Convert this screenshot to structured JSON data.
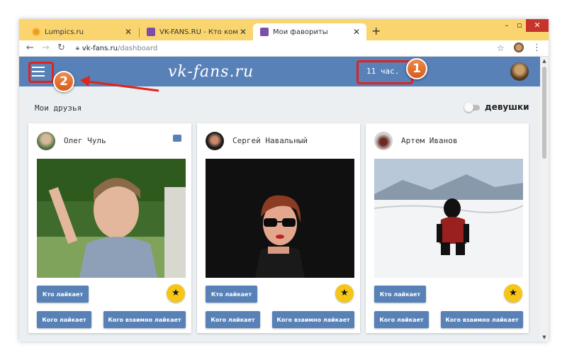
{
  "browser": {
    "tabs": [
      {
        "title": "Lumpics.ru",
        "favicon": "lumpics-favicon"
      },
      {
        "title": "VK-FANS.RU - Кто кому ставит л",
        "favicon": "vk-fans-favicon"
      },
      {
        "title": "Мои фавориты",
        "favicon": "vk-fans-favicon"
      }
    ],
    "new_tab_label": "+",
    "window_controls": {
      "minimize": "–",
      "maximize": "▫",
      "close": "✕"
    },
    "url_host": "vk-fans.ru",
    "url_path": "/dashboard"
  },
  "app": {
    "logo": "vk-fans.ru",
    "timer": "11 час."
  },
  "friends_section": {
    "title": "Мои друзья",
    "toggle_label": "девушки"
  },
  "cards": [
    {
      "name": "Олег Чуль",
      "has_chat_icon": true
    },
    {
      "name": "Сергей Навальный",
      "has_chat_icon": false
    },
    {
      "name": "Артем Иванов",
      "has_chat_icon": false
    }
  ],
  "card_buttons": {
    "who_likes": "Кто лайкает",
    "whom_likes": "Кого лайкает",
    "mutual_likes": "Кого взаимно лайкает"
  },
  "annotations": {
    "badge_1": "1",
    "badge_2": "2",
    "highlight_color": "#e0231d",
    "badge_color": "#e06a27"
  },
  "colors": {
    "accent": "#5881b7",
    "star": "#f5c518",
    "window_frame": "#fad56f"
  }
}
